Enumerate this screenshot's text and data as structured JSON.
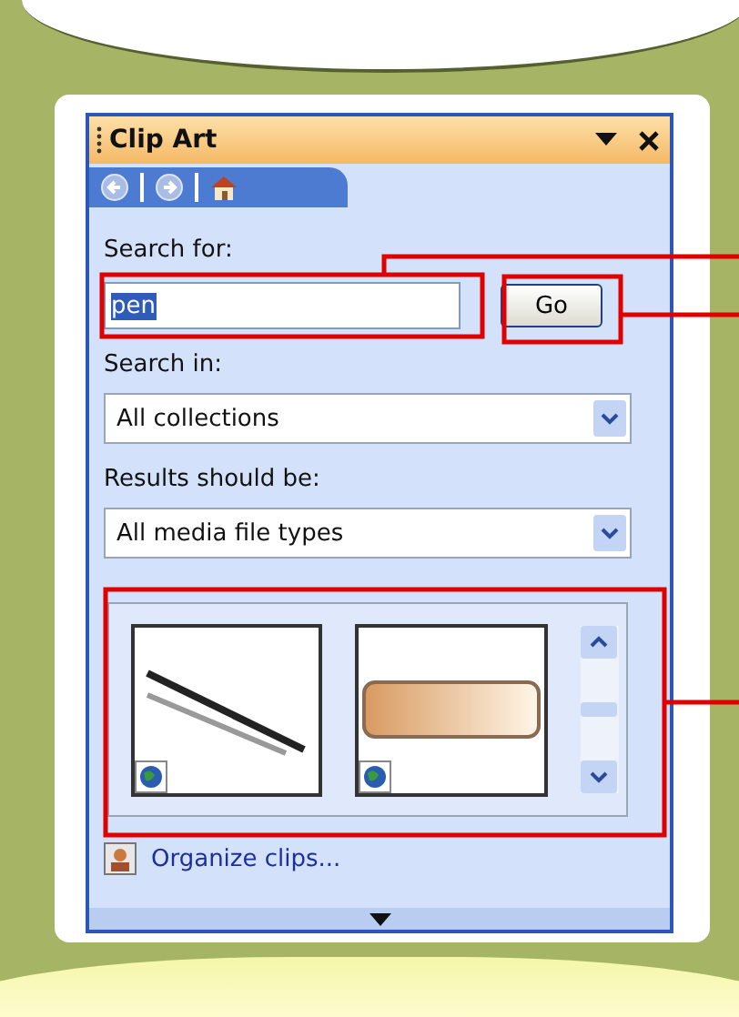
{
  "pane": {
    "title": "Clip Art"
  },
  "search": {
    "label": "Search for:",
    "value": "pen",
    "value_selected": true,
    "button": "Go"
  },
  "search_in": {
    "label": "Search in:",
    "value": "All collections"
  },
  "results_type": {
    "label": "Results should be:",
    "value": "All media file types"
  },
  "results": [
    {
      "kind": "pen-photo"
    },
    {
      "kind": "banner-photo"
    }
  ],
  "organize_link": "Organize clips..."
}
